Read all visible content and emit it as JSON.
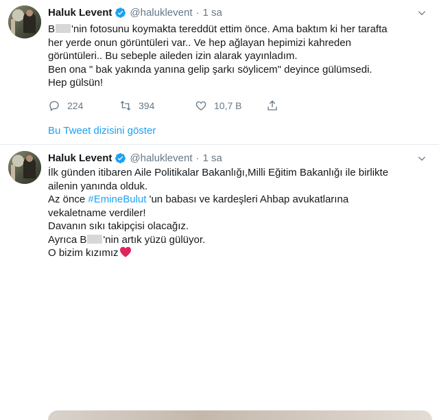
{
  "tweets": [
    {
      "author_name": "Haluk Levent",
      "handle": "@haluklevent",
      "separator": "·",
      "time": "1 sa",
      "lines": [
        [
          "B",
          "'nin fotosunu koymakta tereddüt ettim önce. Ama baktım ki her tarafta"
        ],
        "her yerde onun görüntüleri var.. Ve hep ağlayan hepimizi kahreden",
        "görüntüleri.. Bu sebeple aileden izin alarak yayınladım.",
        "Ben ona \" bak yakında yanına gelip şarkı söylicem\" deyince gülümsedi.",
        "Hep gülsün!"
      ],
      "replies": "224",
      "retweets": "394",
      "likes": "10,7 B",
      "thread_link": "Bu Tweet dizisini göster"
    },
    {
      "author_name": "Haluk Levent",
      "handle": "@haluklevent",
      "separator": "·",
      "time": "1 sa",
      "lines": [
        "İlk günden itibaren Aile Politikalar Bakanlığı,Milli Eğitim Bakanlığı ile birlikte",
        "ailenin yanında olduk.",
        [
          "Az önce ",
          "#EmineBulut",
          " 'un babası ve kardeşleri Ahbap avukatlarına"
        ],
        "vekaletname verdiler!",
        "Davanın sıkı takipçisi olacağız.",
        [
          "Ayrıca B",
          "'nin artık yüzü gülüyor."
        ],
        "O bizim kızımız"
      ]
    }
  ],
  "colors": {
    "accent": "#1da1f2",
    "muted": "#657786",
    "text": "#14171a",
    "heart": "#e0245e"
  },
  "icons": [
    "verified-badge-icon",
    "chevron-down-icon",
    "reply-icon",
    "retweet-icon",
    "like-icon",
    "share-icon",
    "red-heart-emoji"
  ]
}
